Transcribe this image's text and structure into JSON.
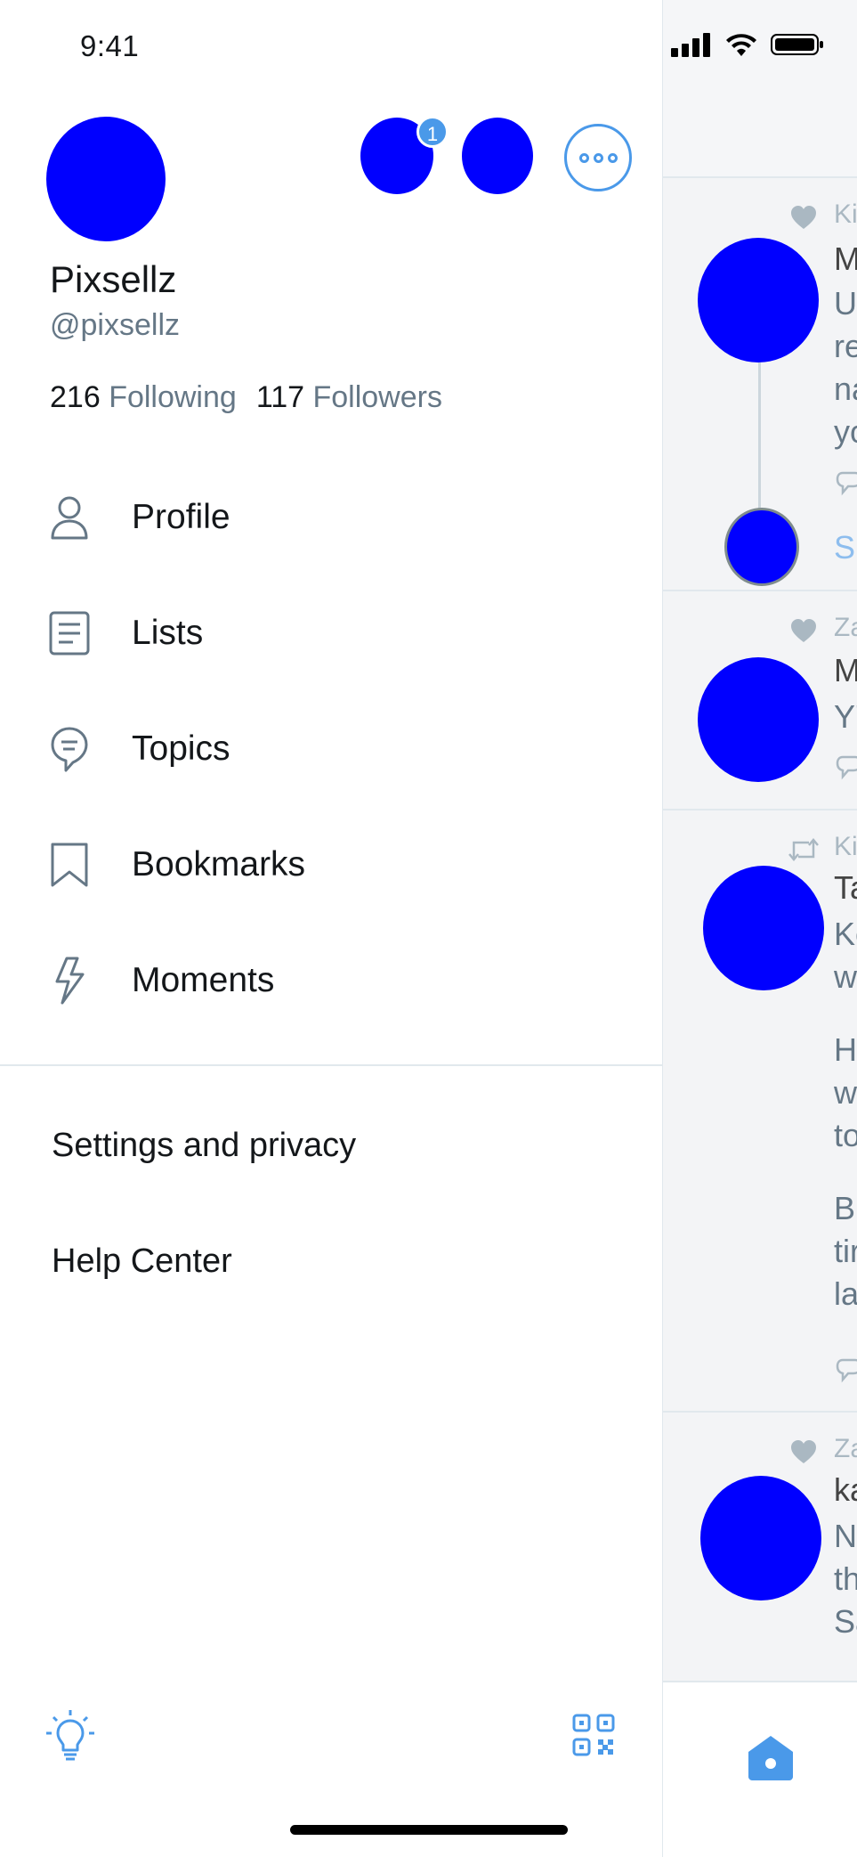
{
  "status_bar": {
    "time": "9:41"
  },
  "drawer": {
    "display_name": "Pixsellz",
    "handle": "@pixsellz",
    "following_count": "216",
    "following_label": "Following",
    "followers_count": "117",
    "followers_label": "Followers",
    "notification_badge": "1",
    "menu": [
      {
        "label": "Profile",
        "icon": "person-icon"
      },
      {
        "label": "Lists",
        "icon": "lists-icon"
      },
      {
        "label": "Topics",
        "icon": "topics-icon"
      },
      {
        "label": "Bookmarks",
        "icon": "bookmark-icon"
      },
      {
        "label": "Moments",
        "icon": "lightning-icon"
      }
    ],
    "secondary": [
      {
        "label": "Settings and privacy"
      },
      {
        "label": "Help Center"
      }
    ],
    "bottom_icons": [
      "lightbulb-icon",
      "qr-code-icon"
    ]
  },
  "timeline": {
    "tweets": [
      {
        "meta": "Ki",
        "meta_icon": "heart-icon",
        "lines": [
          "M",
          "U",
          "re",
          "na",
          "yo"
        ],
        "show_more": "Sh"
      },
      {
        "meta": "Za",
        "meta_icon": "heart-icon",
        "lines": [
          "M",
          "Y'"
        ]
      },
      {
        "meta": "Ki",
        "meta_icon": "retweet-icon",
        "lines": [
          "Ta",
          "Kc",
          "w",
          "H",
          "w",
          "to",
          "Bu",
          "tir",
          "la"
        ]
      },
      {
        "meta": "Za",
        "meta_icon": "heart-icon",
        "lines": [
          "ka",
          "N",
          "th",
          "Sa"
        ]
      }
    ]
  },
  "colors": {
    "accent": "#4a99e9",
    "text": "#14171a",
    "secondary_text": "#657786",
    "avatar": "#0000ff"
  }
}
